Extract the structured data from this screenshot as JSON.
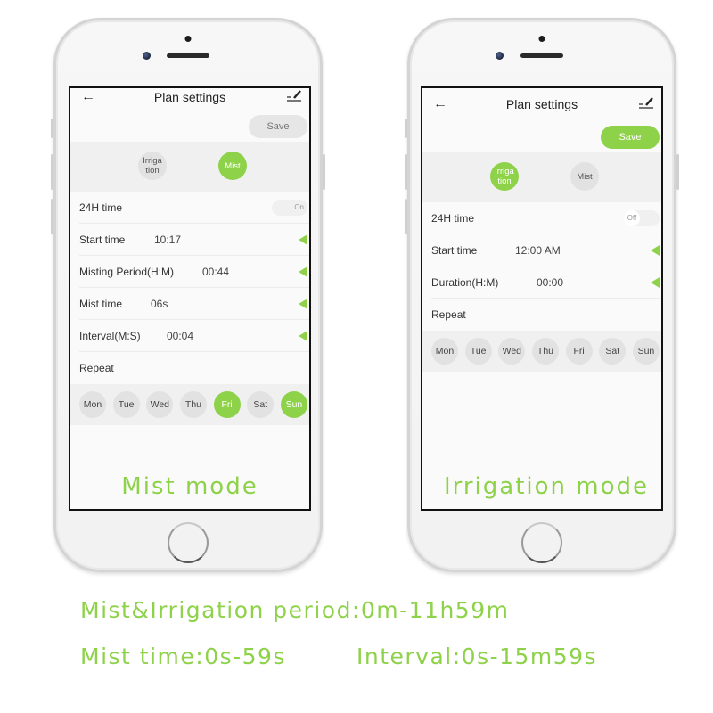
{
  "colors": {
    "accent": "#8ed24a",
    "inactive": "#e2e2e2",
    "screen_bg": "#fafafa"
  },
  "phones": [
    {
      "id": "mist",
      "appbar": {
        "back_icon": "arrow-left-icon",
        "title": "Plan settings",
        "edit_icon": "pencil-icon"
      },
      "save_label": "Save",
      "save_state": "disabled",
      "modes": [
        {
          "label_line1": "Irriga",
          "label_line2": "tion",
          "selected": false
        },
        {
          "label_line1": "Mist",
          "label_line2": "",
          "selected": true
        }
      ],
      "toggle": {
        "label": "24H time",
        "state_label": "On",
        "on": true
      },
      "rows": [
        {
          "label": "Start time",
          "value": "10:17"
        },
        {
          "label": "Misting Period(H:M)",
          "value": "00:44"
        },
        {
          "label": "Mist time",
          "value": "06s"
        },
        {
          "label": "Interval(M:S)",
          "value": "00:04"
        }
      ],
      "repeat_label": "Repeat",
      "days": [
        {
          "label": "Mon",
          "selected": false
        },
        {
          "label": "Tue",
          "selected": false
        },
        {
          "label": "Wed",
          "selected": false
        },
        {
          "label": "Thu",
          "selected": false
        },
        {
          "label": "Fri",
          "selected": true
        },
        {
          "label": "Sat",
          "selected": false
        },
        {
          "label": "Sun",
          "selected": true
        }
      ],
      "caption": "Mist mode"
    },
    {
      "id": "irrigation",
      "appbar": {
        "back_icon": "arrow-left-icon",
        "title": "Plan settings",
        "edit_icon": "pencil-icon"
      },
      "save_label": "Save",
      "save_state": "active",
      "modes": [
        {
          "label_line1": "Irriga",
          "label_line2": "tion",
          "selected": true
        },
        {
          "label_line1": "Mist",
          "label_line2": "",
          "selected": false
        }
      ],
      "toggle": {
        "label": "24H time",
        "state_label": "Off",
        "on": false
      },
      "rows": [
        {
          "label": "Start time",
          "value": "12:00 AM"
        },
        {
          "label": "Duration(H:M)",
          "value": "00:00"
        }
      ],
      "repeat_label": "Repeat",
      "days": [
        {
          "label": "Mon",
          "selected": false
        },
        {
          "label": "Tue",
          "selected": false
        },
        {
          "label": "Wed",
          "selected": false
        },
        {
          "label": "Thu",
          "selected": false
        },
        {
          "label": "Fri",
          "selected": false
        },
        {
          "label": "Sat",
          "selected": false
        },
        {
          "label": "Sun",
          "selected": false
        }
      ],
      "caption": "Irrigation mode"
    }
  ],
  "footer": {
    "line1": "Mist&Irrigation period:0m-11h59m",
    "line2_left": "Mist time:0s-59s",
    "line2_right": "Interval:0s-15m59s"
  }
}
